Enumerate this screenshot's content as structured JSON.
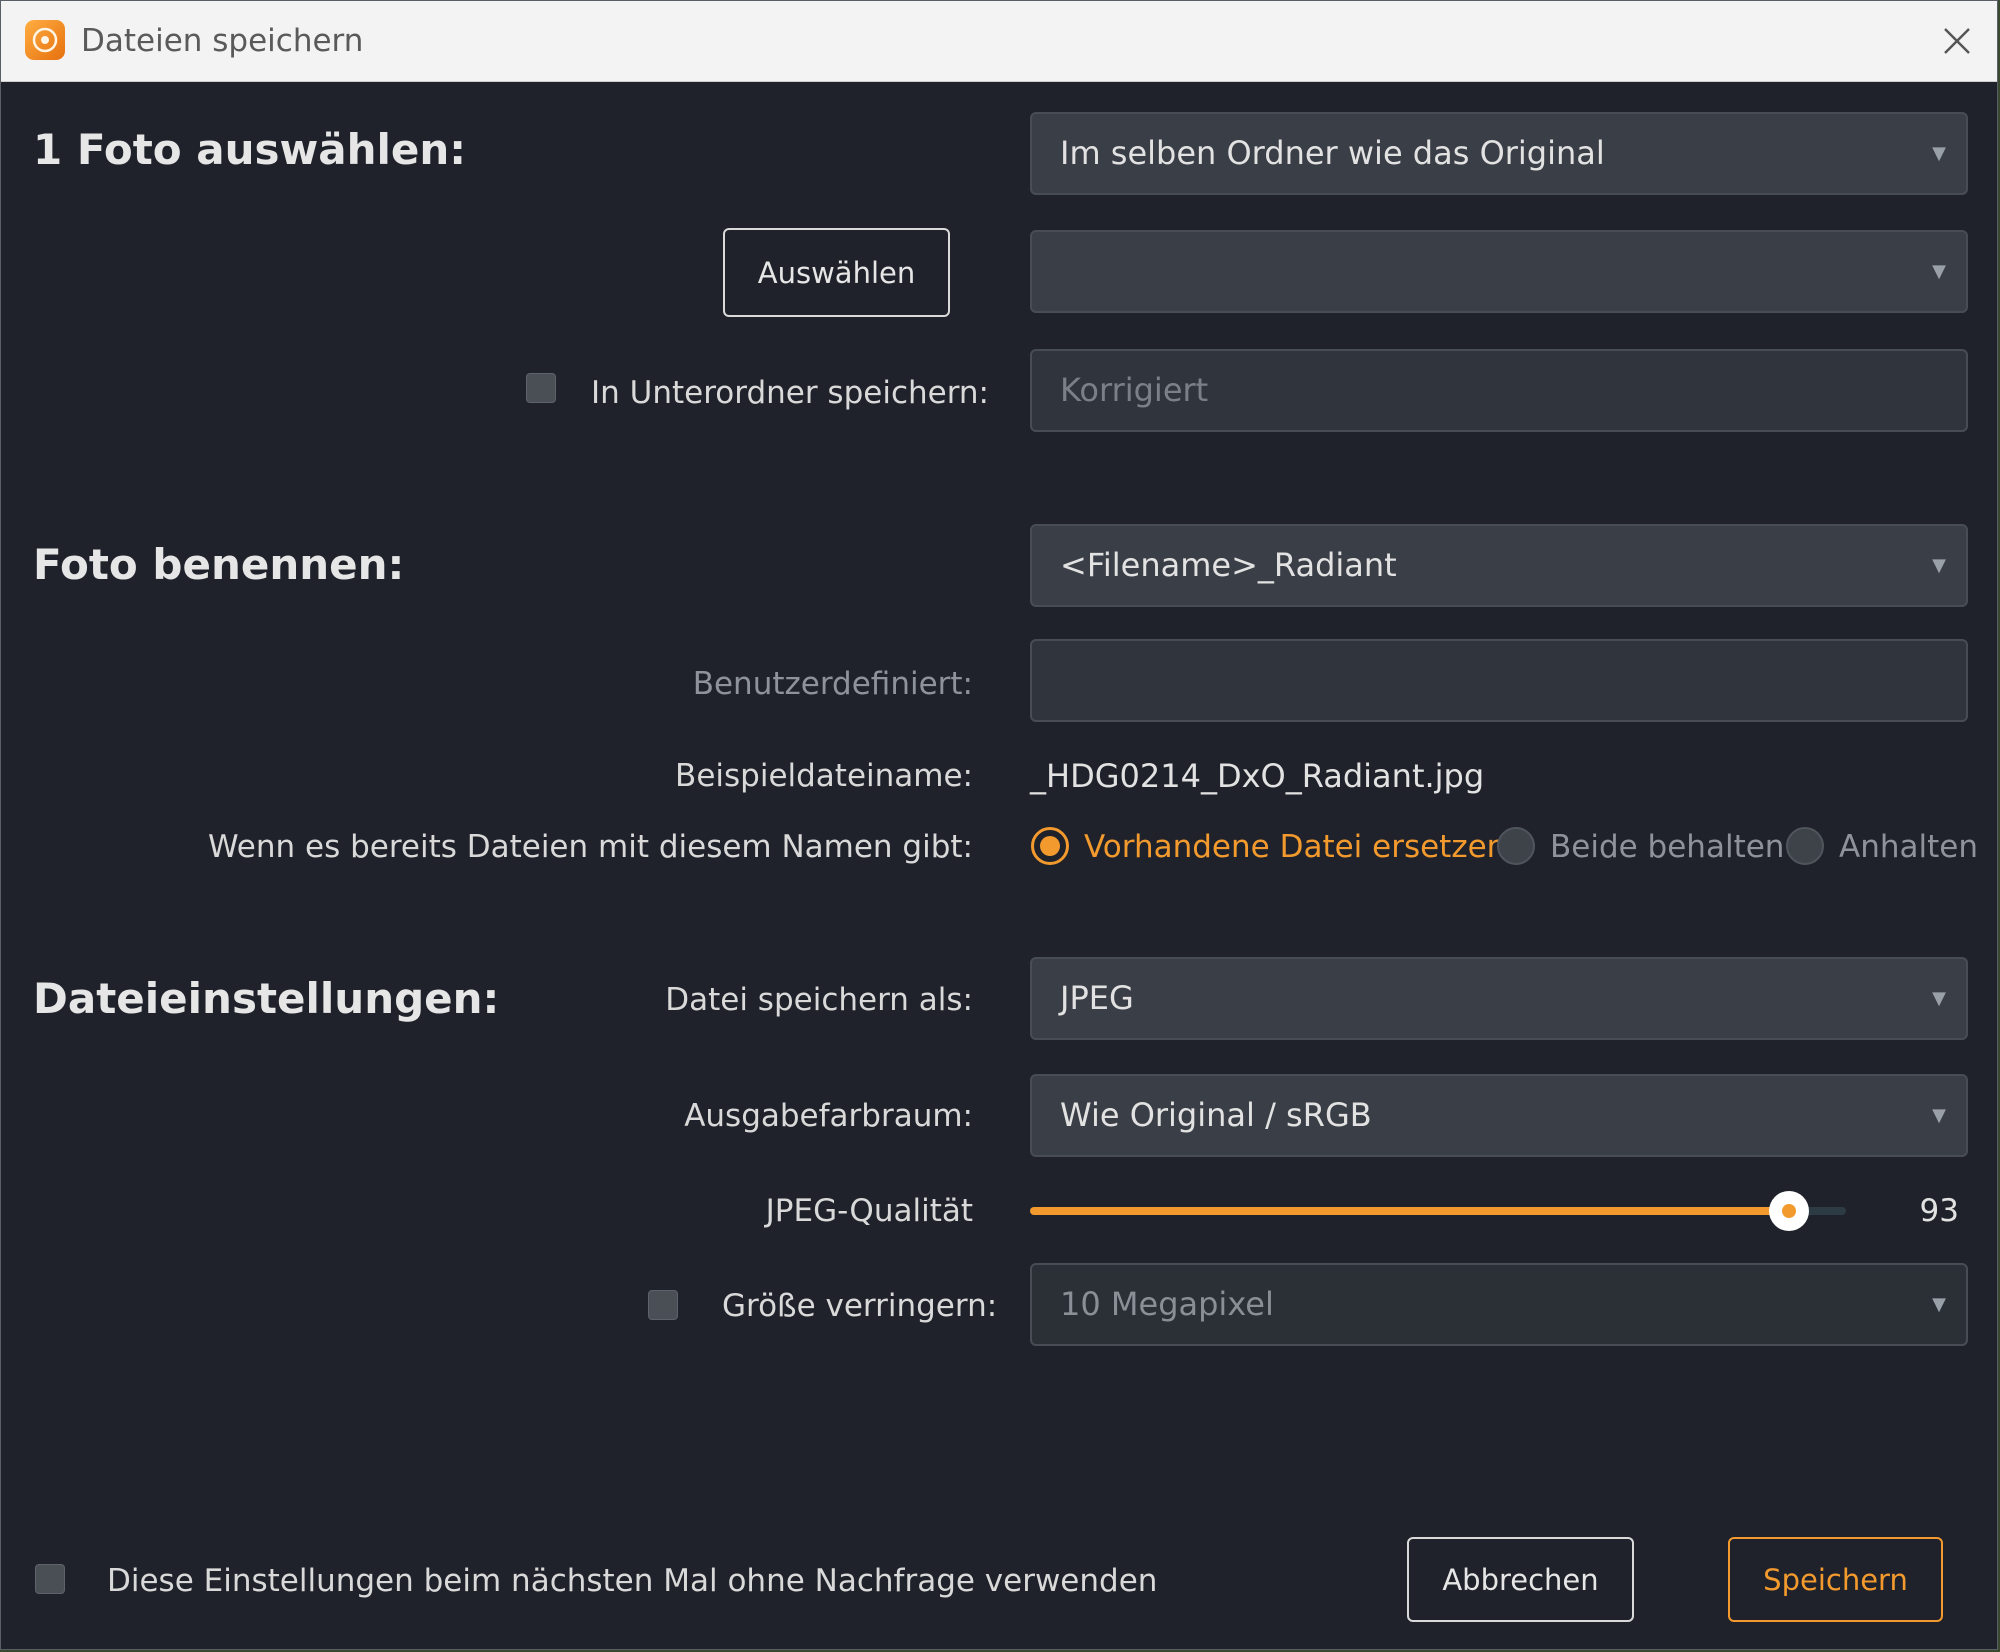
{
  "window": {
    "title": "Dateien speichern",
    "icon": "dxo-app-icon",
    "close_icon": "close-icon"
  },
  "location": {
    "section_title": "1 Foto auswählen:",
    "destination": "Im selben Ordner wie das Original",
    "choose_button": "Auswählen",
    "folder_value": "",
    "subfolder_label": "In Unterordner speichern:",
    "subfolder_checked": false,
    "subfolder_placeholder": "Korrigiert"
  },
  "naming": {
    "section_title": "Foto benennen:",
    "pattern": "<Filename>_Radiant",
    "custom_label": "Benutzerdefiniert:",
    "custom_value": "",
    "example_label": "Beispieldateiname:",
    "example_value": "_HDG0214_DxO_Radiant.jpg",
    "conflict_label": "Wenn es bereits Dateien mit diesem Namen gibt:",
    "conflict_options": [
      {
        "label": "Vorhandene Datei ersetzen",
        "selected": true
      },
      {
        "label": "Beide behalten",
        "selected": false
      },
      {
        "label": "Anhalten",
        "selected": false
      }
    ]
  },
  "file_settings": {
    "section_title": "Dateieinstellungen:",
    "format_label": "Datei speichern als:",
    "format_value": "JPEG",
    "colorspace_label": "Ausgabefarbraum:",
    "colorspace_value": "Wie Original / sRGB",
    "quality_label": "JPEG-Qualität",
    "quality_value": 93,
    "quality_display": "93",
    "resize_label": "Größe verringern:",
    "resize_checked": false,
    "resize_value": "10 Megapixel"
  },
  "footer": {
    "remember_label": "Diese Einstellungen beim nächsten Mal ohne Nachfrage verwenden",
    "remember_checked": false,
    "cancel_button": "Abbrechen",
    "save_button": "Speichern"
  },
  "colors": {
    "accent": "#f39a2e",
    "background": "#1f222a",
    "field": "#3a3e46"
  }
}
